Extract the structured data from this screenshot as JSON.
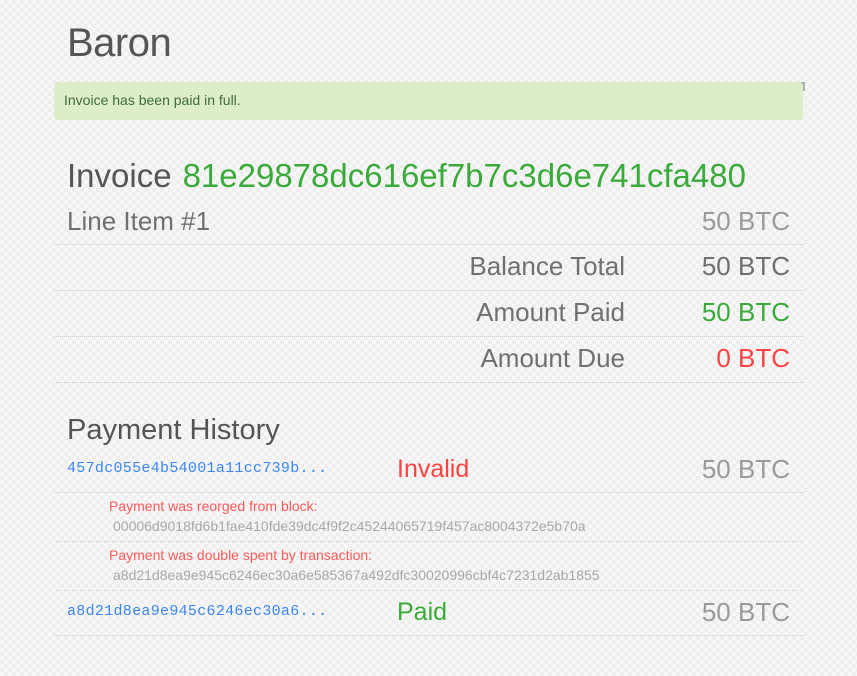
{
  "brand": "Baron",
  "alert": {
    "message": "Invoice has been paid in full."
  },
  "invoice": {
    "label": "Invoice",
    "id": "81e29878dc616ef7b7c3d6e741cfa480",
    "line_items": [
      {
        "label": "Line Item #1",
        "amount": "50 BTC"
      }
    ]
  },
  "totals": [
    {
      "label": "Balance Total",
      "amount": "50 BTC",
      "tone": "dark"
    },
    {
      "label": "Amount Paid",
      "amount": "50 BTC",
      "tone": "green"
    },
    {
      "label": "Amount Due",
      "amount": "0 BTC",
      "tone": "red"
    }
  ],
  "history": {
    "title": "Payment History",
    "payments": [
      {
        "txid": "457dc055e4b54001a11cc739b...",
        "status": "Invalid",
        "status_tone": "invalid",
        "amount": "50 BTC",
        "errors": [
          {
            "message": "Payment was reorged from block:",
            "hash": "00006d9018fd6b1fae410fde39dc4f9f2c45244065719f457ac8004372e5b70a"
          },
          {
            "message": "Payment was double spent by transaction:",
            "hash": "a8d21d8ea9e945c6246ec30a6e585367a492dfc30020996cbf4c7231d2ab1855"
          }
        ]
      },
      {
        "txid": "a8d21d8ea9e945c6246ec30a6...",
        "status": "Paid",
        "status_tone": "paid",
        "amount": "50 BTC",
        "errors": []
      }
    ]
  },
  "colors": {
    "green": "#3aab3a",
    "red": "#fc4343",
    "link": "#3b87f0",
    "muted": "#9a9a9a",
    "alert_bg": "#dcedc8",
    "alert_bar": "#b0b0b0"
  }
}
